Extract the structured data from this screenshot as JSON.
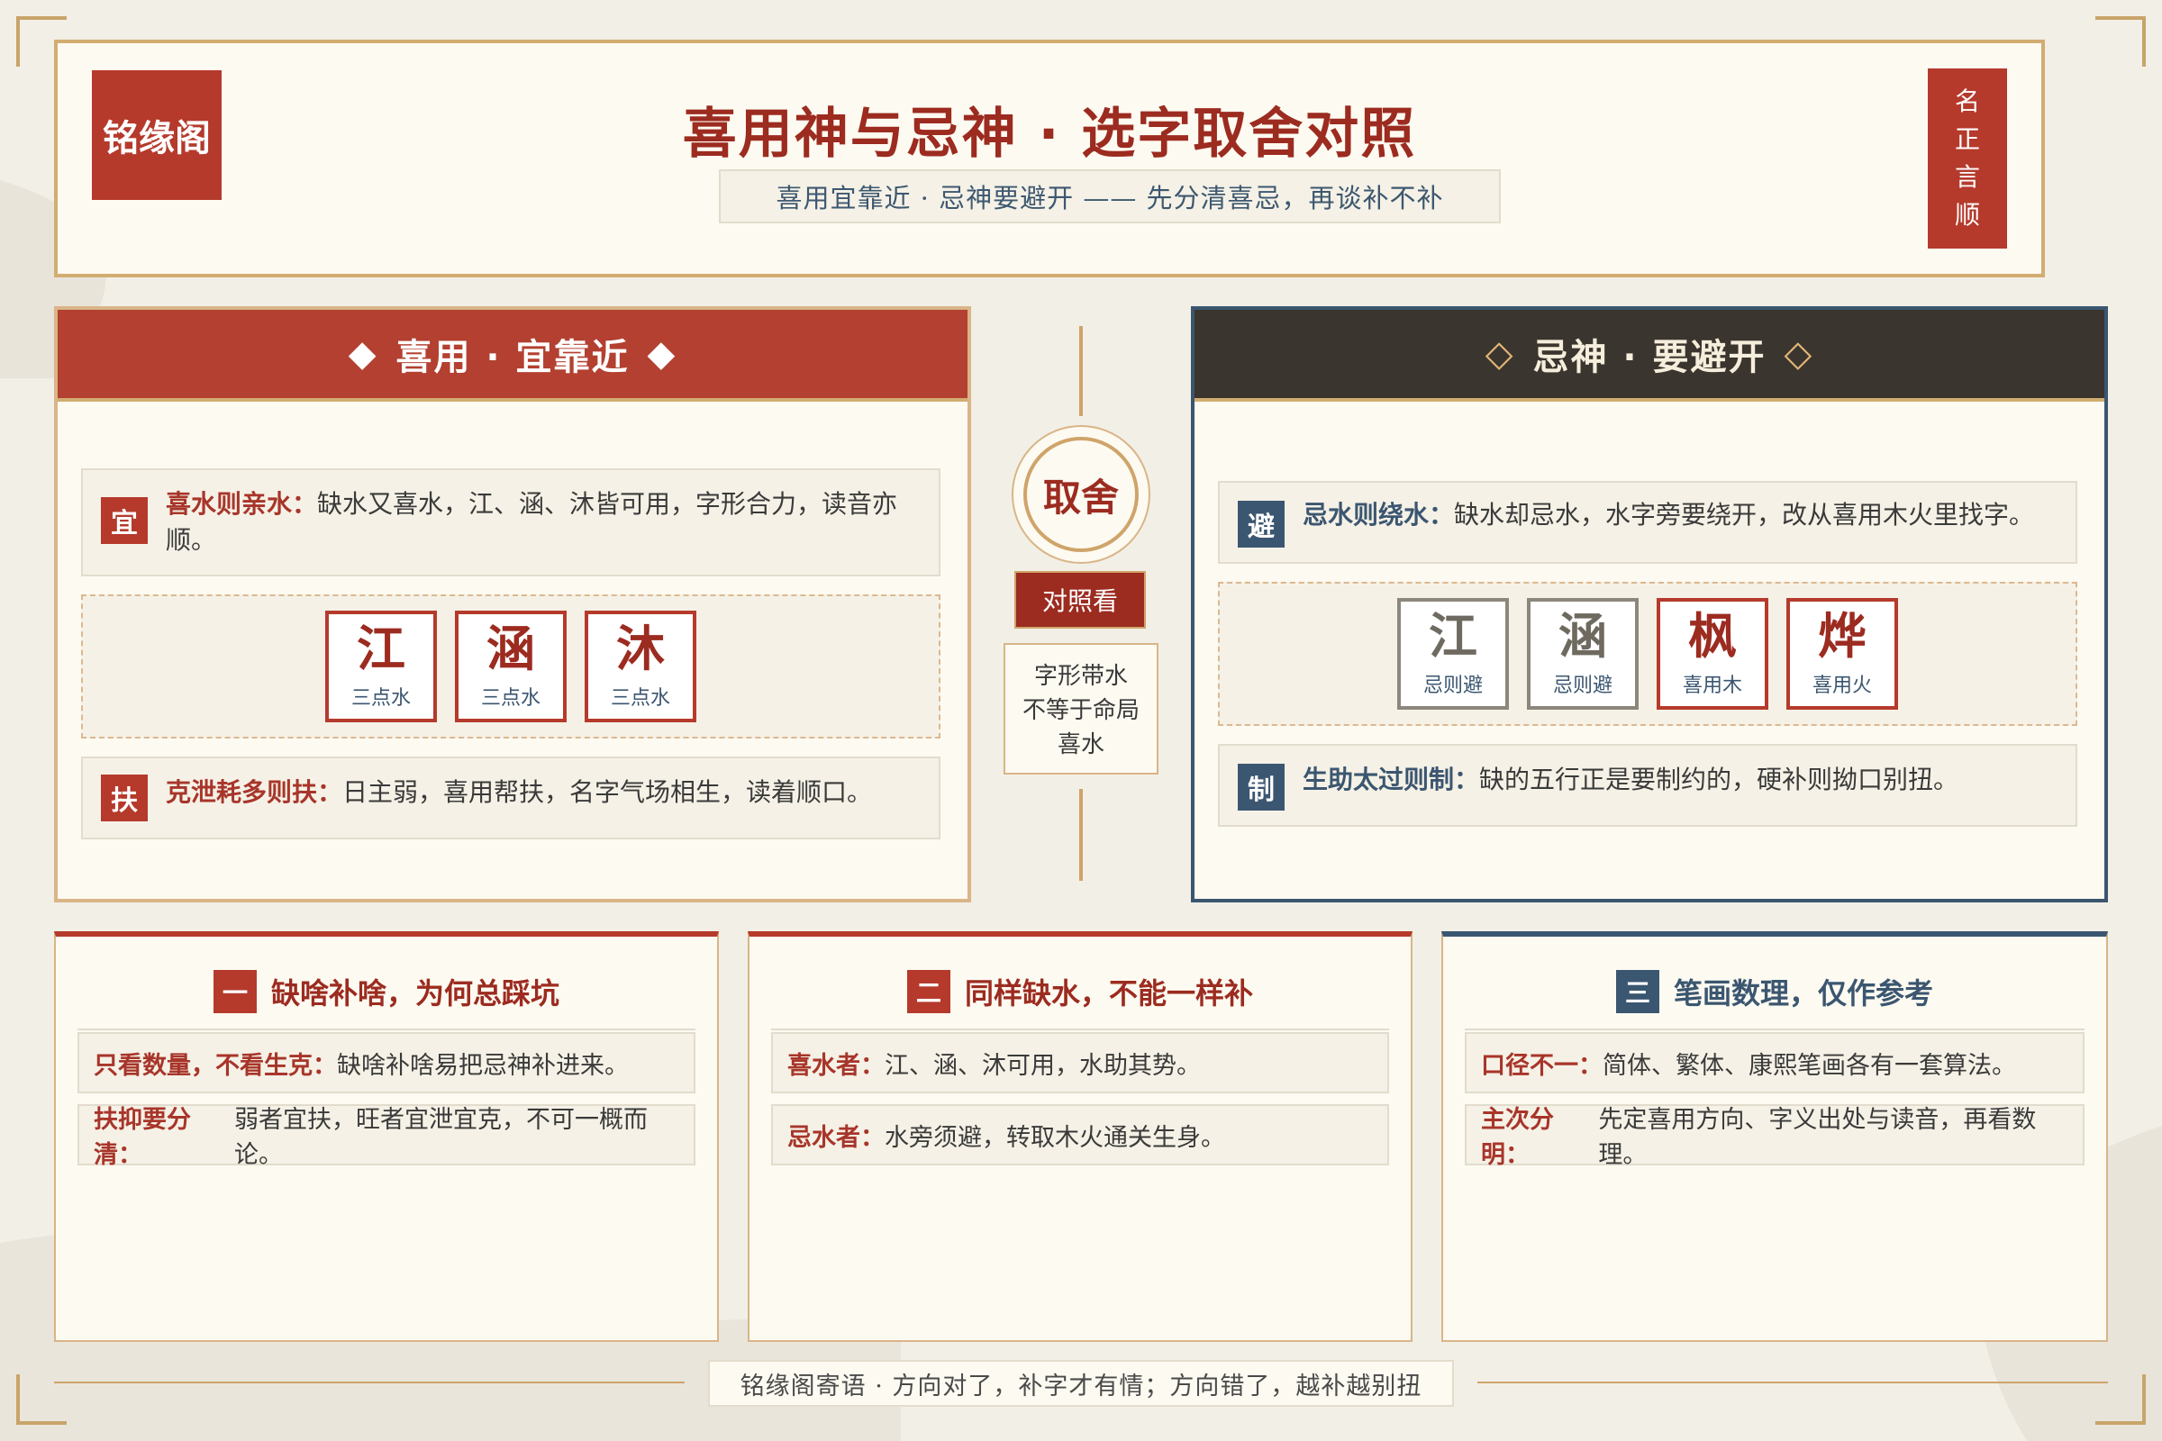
{
  "brand": "铭缘阁",
  "header": {
    "title": "喜用神与忌神 · 选字取舍对照",
    "subtitle": "喜用宜靠近 · 忌神要避开 —— 先分清喜忌，再谈补不补",
    "badge_chars": [
      "名",
      "正",
      "言",
      "顺"
    ]
  },
  "left_panel": {
    "title": "喜用 · 宜靠近",
    "rules": [
      {
        "badge": "宜",
        "lead": "喜水则亲水：",
        "text": "缺水又喜水，江、涵、沐皆可用，字形合力，读音亦顺。"
      },
      {
        "badge": "扶",
        "lead": "克泄耗多则扶：",
        "text": "日主弱，喜用帮扶，名字气场相生，读着顺口。"
      }
    ],
    "chars": [
      {
        "char": "江",
        "note": "三点水"
      },
      {
        "char": "涵",
        "note": "三点水"
      },
      {
        "char": "沐",
        "note": "三点水"
      }
    ]
  },
  "center": {
    "circle": "取舍",
    "tag": "对照看",
    "note": [
      "字形带水",
      "不等于命局",
      "喜水"
    ]
  },
  "right_panel": {
    "title": "忌神 · 要避开",
    "rules": [
      {
        "badge": "避",
        "lead": "忌水则绕水：",
        "text": "缺水却忌水，水字旁要绕开，改从喜用木火里找字。"
      },
      {
        "badge": "制",
        "lead": "生助太过则制：",
        "text": "缺的五行正是要制约的，硬补则拗口别扭。"
      }
    ],
    "chars": [
      {
        "char": "江",
        "note": "忌则避",
        "style": "grey"
      },
      {
        "char": "涵",
        "note": "忌则避",
        "style": "grey"
      },
      {
        "char": "枫",
        "note": "喜用木",
        "style": "red"
      },
      {
        "char": "烨",
        "note": "喜用火",
        "style": "red"
      }
    ]
  },
  "cards": [
    {
      "num": "一",
      "title": "缺啥补啥，为何总踩坑",
      "rows": [
        {
          "lead": "只看数量，不看生克：",
          "text": "缺啥补啥易把忌神补进来。"
        },
        {
          "lead": "扶抑要分清：",
          "text": "弱者宜扶，旺者宜泄宜克，不可一概而论。"
        }
      ]
    },
    {
      "num": "二",
      "title": "同样缺水，不能一样补",
      "rows": [
        {
          "lead": "喜水者：",
          "text": "江、涵、沐可用，水助其势。"
        },
        {
          "lead": "忌水者：",
          "text": "水旁须避，转取木火通关生身。"
        }
      ]
    },
    {
      "num": "三",
      "title": "笔画数理，仅作参考",
      "rows": [
        {
          "lead": "口径不一：",
          "text": "简体、繁体、康熙笔画各有一套算法。"
        },
        {
          "lead": "主次分明：",
          "text": "先定喜用方向、字义出处与读音，再看数理。"
        }
      ]
    }
  ],
  "footer": "铭缘阁寄语 · 方向对了，补字才有情；方向错了，越补越别扭",
  "colors": {
    "accent_red": "#b53a2c",
    "accent_blue": "#3b5670",
    "gold": "#d2ad72",
    "paper": "#fdfaf1"
  }
}
